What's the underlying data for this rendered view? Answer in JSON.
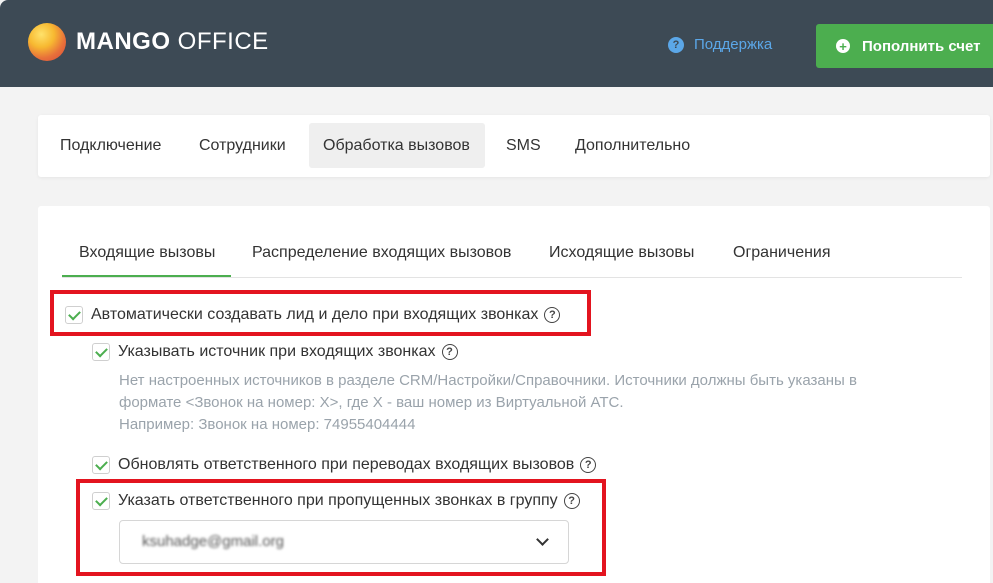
{
  "header": {
    "logo_bold": "MANGO",
    "logo_light": " OFFICE",
    "support_label": "Поддержка",
    "topup_label": "Пополнить счет",
    "icons": [
      "help-circle-icon",
      "plus-circle-icon"
    ],
    "colors": {
      "bar": "#3d4a55",
      "accent_green": "#4cae4f",
      "link_blue": "#5ba7e8"
    }
  },
  "main_nav": {
    "tabs": [
      "Подключение",
      "Сотрудники",
      "Обработка вызовов",
      "SMS",
      "Дополнительно"
    ],
    "active": "Обработка вызовов"
  },
  "sub_nav": {
    "tabs": [
      "Входящие вызовы",
      "Распределение входящих вызовов",
      "Исходящие вызовы",
      "Ограничения"
    ],
    "active": "Входящие вызовы"
  },
  "settings": {
    "auto_lead": {
      "label": "Автоматически создавать лид и дело при входящих звонках",
      "checked": true
    },
    "source": {
      "label": "Указывать источник при входящих звонках",
      "checked": true,
      "hint_line1": "Нет настроенных источников в разделе CRM/Настройки/Справочники. Источники должны быть указаны в",
      "hint_line2": "формате <Звонок на номер: X>, где X - ваш номер из Виртуальной АТС.",
      "hint_line3": "Например: Звонок на номер: 74955404444"
    },
    "update_responsible": {
      "label": "Обновлять ответственного при переводах входящих вызовов",
      "checked": true
    },
    "missed_group": {
      "label": "Указать ответственного при пропущенных звонках в группу",
      "checked": true,
      "select_value": "ksuhadge@gmail.org"
    }
  },
  "highlight_color": "#e3141f"
}
